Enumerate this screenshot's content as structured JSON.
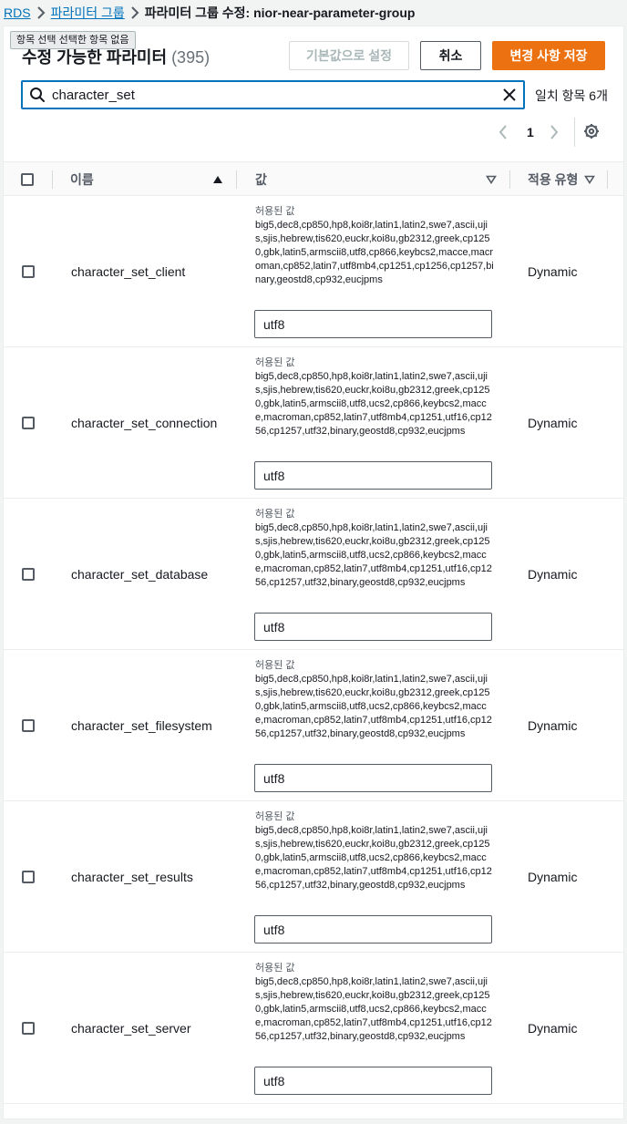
{
  "breadcrumb": {
    "root": "RDS",
    "parent": "파라미터 그룹",
    "current": "파라미터 그룹 수정: nior-near-parameter-group"
  },
  "tooltip": "항목 선택 선택한 항목 없음",
  "header": {
    "title": "수정 가능한 파라미터",
    "count": "(395)",
    "buttons": {
      "reset_label": "기본값으로 설정",
      "cancel_label": "취소",
      "save_label": "변경 사항 저장"
    }
  },
  "search": {
    "value": "character_set",
    "match_text": "일치 항목 6개"
  },
  "pagination": {
    "current_page": "1"
  },
  "table": {
    "columns": {
      "name": "이름",
      "value": "값",
      "apply_type": "적용 유형"
    },
    "allowed_label": "허용된 값",
    "rows": [
      {
        "name": "character_set_client",
        "allowed": "big5,dec8,cp850,hp8,koi8r,latin1,latin2,swe7,ascii,ujis,sjis,hebrew,tis620,euckr,koi8u,gb2312,greek,cp1250,gbk,latin5,armscii8,utf8,cp866,keybcs2,macce,macroman,cp852,latin7,utf8mb4,cp1251,cp1256,cp1257,binary,geostd8,cp932,eucjpms",
        "value": "utf8",
        "apply_type": "Dynamic"
      },
      {
        "name": "character_set_connection",
        "allowed": "big5,dec8,cp850,hp8,koi8r,latin1,latin2,swe7,ascii,ujis,sjis,hebrew,tis620,euckr,koi8u,gb2312,greek,cp1250,gbk,latin5,armscii8,utf8,ucs2,cp866,keybcs2,macce,macroman,cp852,latin7,utf8mb4,cp1251,utf16,cp1256,cp1257,utf32,binary,geostd8,cp932,eucjpms",
        "value": "utf8",
        "apply_type": "Dynamic"
      },
      {
        "name": "character_set_database",
        "allowed": "big5,dec8,cp850,hp8,koi8r,latin1,latin2,swe7,ascii,ujis,sjis,hebrew,tis620,euckr,koi8u,gb2312,greek,cp1250,gbk,latin5,armscii8,utf8,ucs2,cp866,keybcs2,macce,macroman,cp852,latin7,utf8mb4,cp1251,utf16,cp1256,cp1257,utf32,binary,geostd8,cp932,eucjpms",
        "value": "utf8",
        "apply_type": "Dynamic"
      },
      {
        "name": "character_set_filesystem",
        "allowed": "big5,dec8,cp850,hp8,koi8r,latin1,latin2,swe7,ascii,ujis,sjis,hebrew,tis620,euckr,koi8u,gb2312,greek,cp1250,gbk,latin5,armscii8,utf8,ucs2,cp866,keybcs2,macce,macroman,cp852,latin7,utf8mb4,cp1251,utf16,cp1256,cp1257,utf32,binary,geostd8,cp932,eucjpms",
        "value": "utf8",
        "apply_type": "Dynamic"
      },
      {
        "name": "character_set_results",
        "allowed": "big5,dec8,cp850,hp8,koi8r,latin1,latin2,swe7,ascii,ujis,sjis,hebrew,tis620,euckr,koi8u,gb2312,greek,cp1250,gbk,latin5,armscii8,utf8,ucs2,cp866,keybcs2,macce,macroman,cp852,latin7,utf8mb4,cp1251,utf16,cp1256,cp1257,utf32,binary,geostd8,cp932,eucjpms",
        "value": "utf8",
        "apply_type": "Dynamic"
      },
      {
        "name": "character_set_server",
        "allowed": "big5,dec8,cp850,hp8,koi8r,latin1,latin2,swe7,ascii,ujis,sjis,hebrew,tis620,euckr,koi8u,gb2312,greek,cp1250,gbk,latin5,armscii8,utf8,ucs2,cp866,keybcs2,macce,macroman,cp852,latin7,utf8mb4,cp1251,utf16,cp1256,cp1257,utf32,binary,geostd8,cp932,eucjpms",
        "value": "utf8",
        "apply_type": "Dynamic"
      }
    ]
  },
  "colors": {
    "primary": "#ec7211",
    "link": "#0073bb",
    "text": "#16191f",
    "muted": "#545b64"
  }
}
